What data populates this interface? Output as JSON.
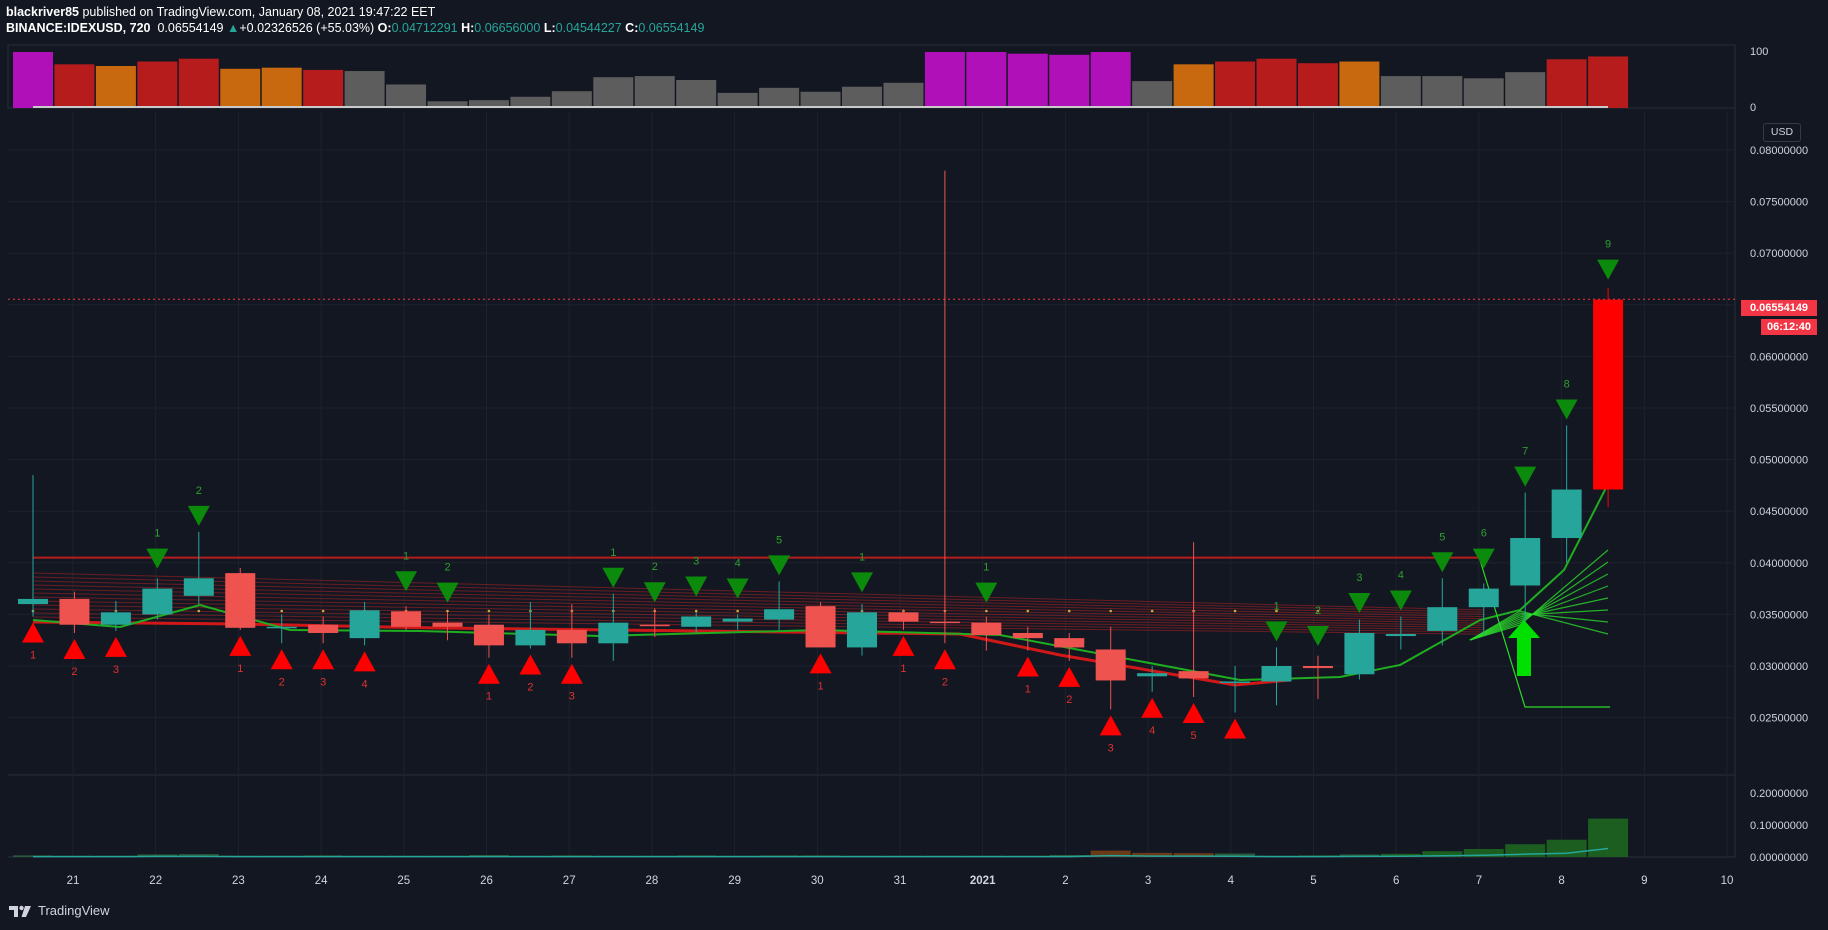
{
  "header": {
    "publisher": "blackriver85",
    "published_text": "published on TradingView.com, January 08, 2021 19:47:22 EET",
    "symbol": "BINANCE:IDEXUSD, 720",
    "last_price": "0.06554149",
    "change_arrow": "▲",
    "change": "+0.02326526 (+55.03%)",
    "open_label": "O:",
    "open": "0.04712291",
    "high_label": "H:",
    "high": "0.06656000",
    "low_label": "L:",
    "low": "0.04544227",
    "close_label": "C:",
    "close": "0.06554149"
  },
  "price_axis": {
    "currency": "USD",
    "ticks": [
      "0.08000000",
      "0.07500000",
      "0.07000000",
      "0.06500000",
      "0.06000000",
      "0.05500000",
      "0.05000000",
      "0.04500000",
      "0.04000000",
      "0.03500000",
      "0.03000000",
      "0.02500000"
    ],
    "last_price_tag": "0.06554149",
    "countdown_tag": "06:12:40"
  },
  "top_pane_axis": {
    "ticks": [
      "100",
      "0"
    ]
  },
  "volume_axis": {
    "ticks": [
      "0.20000000",
      "0.10000000",
      "0.00000000"
    ]
  },
  "time_axis": {
    "labels": [
      "21",
      "22",
      "23",
      "24",
      "25",
      "26",
      "27",
      "28",
      "29",
      "30",
      "31",
      "2021",
      "2",
      "3",
      "4",
      "5",
      "6",
      "7",
      "8",
      "9",
      "10"
    ]
  },
  "footer": {
    "brand": "TradingView"
  },
  "colors": {
    "background": "#131722",
    "up_candle": "#26a69a",
    "down_candle": "#ef5350",
    "last_candle": "#ff0000",
    "price_line": "#f23645",
    "sell_marker": "#0b8a0b",
    "buy_marker": "#ff0000",
    "bar_magenta": "#b010b8",
    "bar_red": "#b71c1c",
    "bar_orange": "#c8680f",
    "bar_gray": "#5d5d5d"
  },
  "chart_data": {
    "type": "candlestick",
    "symbol": "BINANCE:IDEXUSD",
    "interval": "720",
    "ohlc": [
      {
        "o": 0.036,
        "h": 0.0485,
        "l": 0.0348,
        "c": 0.0365
      },
      {
        "o": 0.0365,
        "h": 0.0372,
        "l": 0.0332,
        "c": 0.034
      },
      {
        "o": 0.034,
        "h": 0.0363,
        "l": 0.0334,
        "c": 0.0352
      },
      {
        "o": 0.035,
        "h": 0.0385,
        "l": 0.0345,
        "c": 0.0375
      },
      {
        "o": 0.0368,
        "h": 0.043,
        "l": 0.036,
        "c": 0.0385
      },
      {
        "o": 0.039,
        "h": 0.0395,
        "l": 0.0335,
        "c": 0.0337
      },
      {
        "o": 0.0337,
        "h": 0.035,
        "l": 0.0322,
        "c": 0.0338
      },
      {
        "o": 0.034,
        "h": 0.0348,
        "l": 0.0322,
        "c": 0.0332
      },
      {
        "o": 0.0327,
        "h": 0.0362,
        "l": 0.032,
        "c": 0.0354
      },
      {
        "o": 0.0353,
        "h": 0.0358,
        "l": 0.0335,
        "c": 0.0338
      },
      {
        "o": 0.0342,
        "h": 0.0352,
        "l": 0.0325,
        "c": 0.0338
      },
      {
        "o": 0.034,
        "h": 0.035,
        "l": 0.0308,
        "c": 0.032
      },
      {
        "o": 0.032,
        "h": 0.0362,
        "l": 0.0317,
        "c": 0.0335
      },
      {
        "o": 0.0335,
        "h": 0.036,
        "l": 0.0308,
        "c": 0.0322
      },
      {
        "o": 0.0322,
        "h": 0.037,
        "l": 0.0305,
        "c": 0.0342
      },
      {
        "o": 0.034,
        "h": 0.0356,
        "l": 0.0328,
        "c": 0.0339
      },
      {
        "o": 0.0338,
        "h": 0.0352,
        "l": 0.0332,
        "c": 0.0348
      },
      {
        "o": 0.0343,
        "h": 0.035,
        "l": 0.0335,
        "c": 0.0346
      },
      {
        "o": 0.0345,
        "h": 0.0382,
        "l": 0.0335,
        "c": 0.0355
      },
      {
        "o": 0.0358,
        "h": 0.0362,
        "l": 0.0318,
        "c": 0.0318
      },
      {
        "o": 0.0318,
        "h": 0.036,
        "l": 0.031,
        "c": 0.0352
      },
      {
        "o": 0.0352,
        "h": 0.0355,
        "l": 0.0335,
        "c": 0.0343
      },
      {
        "o": 0.0343,
        "h": 0.078,
        "l": 0.0322,
        "c": 0.0342
      },
      {
        "o": 0.0342,
        "h": 0.0348,
        "l": 0.0315,
        "c": 0.033
      },
      {
        "o": 0.0332,
        "h": 0.0338,
        "l": 0.0315,
        "c": 0.0327
      },
      {
        "o": 0.0327,
        "h": 0.0332,
        "l": 0.0305,
        "c": 0.0318
      },
      {
        "o": 0.0316,
        "h": 0.0338,
        "l": 0.0258,
        "c": 0.0286
      },
      {
        "o": 0.029,
        "h": 0.03,
        "l": 0.0275,
        "c": 0.0293
      },
      {
        "o": 0.0295,
        "h": 0.042,
        "l": 0.027,
        "c": 0.0288
      },
      {
        "o": 0.0285,
        "h": 0.03,
        "l": 0.0255,
        "c": 0.0285
      },
      {
        "o": 0.0285,
        "h": 0.0318,
        "l": 0.0262,
        "c": 0.03
      },
      {
        "o": 0.03,
        "h": 0.031,
        "l": 0.0268,
        "c": 0.0298
      },
      {
        "o": 0.0292,
        "h": 0.0345,
        "l": 0.0287,
        "c": 0.0332
      },
      {
        "o": 0.0329,
        "h": 0.0348,
        "l": 0.0316,
        "c": 0.0331
      },
      {
        "o": 0.0334,
        "h": 0.0385,
        "l": 0.032,
        "c": 0.0357
      },
      {
        "o": 0.0357,
        "h": 0.038,
        "l": 0.033,
        "c": 0.0375
      },
      {
        "o": 0.0378,
        "h": 0.0468,
        "l": 0.034,
        "c": 0.0424
      },
      {
        "o": 0.0424,
        "h": 0.0533,
        "l": 0.04,
        "c": 0.0471
      },
      {
        "o": 0.0471,
        "h": 0.0666,
        "l": 0.0454,
        "c": 0.0655
      }
    ],
    "volume": [
      0.005,
      0.004,
      0.004,
      0.008,
      0.009,
      0.004,
      0.004,
      0.005,
      0.004,
      0.004,
      0.004,
      0.006,
      0.004,
      0.005,
      0.004,
      0.004,
      0.005,
      0.004,
      0.005,
      0.005,
      0.004,
      0.004,
      0.004,
      0.004,
      0.004,
      0.006,
      0.02,
      0.013,
      0.012,
      0.011,
      0.004,
      0.005,
      0.008,
      0.01,
      0.018,
      0.025,
      0.04,
      0.054,
      0.12
    ],
    "top_pane_values": [
      100,
      78,
      75,
      83,
      88,
      70,
      72,
      68,
      66,
      42,
      12,
      14,
      20,
      30,
      55,
      57,
      50,
      27,
      36,
      29,
      38,
      45,
      100,
      100,
      97,
      95,
      100,
      48,
      78,
      83,
      88,
      80,
      83,
      57,
      57,
      53,
      64,
      87,
      92
    ],
    "sell_markers": [
      {
        "bar": 3,
        "label": "1"
      },
      {
        "bar": 4,
        "label": "2"
      },
      {
        "bar": 9,
        "label": "1"
      },
      {
        "bar": 10,
        "label": "2"
      },
      {
        "bar": 14,
        "label": "1"
      },
      {
        "bar": 15,
        "label": "2"
      },
      {
        "bar": 16,
        "label": "3"
      },
      {
        "bar": 17,
        "label": "4"
      },
      {
        "bar": 18,
        "label": "5"
      },
      {
        "bar": 20,
        "label": "1"
      },
      {
        "bar": 23,
        "label": "1"
      },
      {
        "bar": 30,
        "label": "1"
      },
      {
        "bar": 31,
        "label": "2"
      },
      {
        "bar": 32,
        "label": "3"
      },
      {
        "bar": 33,
        "label": "4"
      },
      {
        "bar": 34,
        "label": "5"
      },
      {
        "bar": 35,
        "label": "6"
      },
      {
        "bar": 36,
        "label": "7"
      },
      {
        "bar": 37,
        "label": "8"
      },
      {
        "bar": 38,
        "label": "9"
      }
    ],
    "buy_markers": [
      {
        "bar": 0,
        "label": "1"
      },
      {
        "bar": 1,
        "label": "2"
      },
      {
        "bar": 2,
        "label": "3"
      },
      {
        "bar": 5,
        "label": "1"
      },
      {
        "bar": 6,
        "label": "2"
      },
      {
        "bar": 7,
        "label": "3"
      },
      {
        "bar": 8,
        "label": "4"
      },
      {
        "bar": 11,
        "label": "1"
      },
      {
        "bar": 12,
        "label": "2"
      },
      {
        "bar": 13,
        "label": "3"
      },
      {
        "bar": 19,
        "label": "1"
      },
      {
        "bar": 21,
        "label": "1"
      },
      {
        "bar": 22,
        "label": "2"
      },
      {
        "bar": 24,
        "label": "1"
      },
      {
        "bar": 25,
        "label": "2"
      },
      {
        "bar": 26,
        "label": "3"
      },
      {
        "bar": 27,
        "label": "4"
      },
      {
        "bar": 28,
        "label": "5"
      },
      {
        "bar": 29,
        "label": ""
      }
    ],
    "resistance_line": 0.0405,
    "last_price": 0.06554149,
    "ylim": [
      0.0215,
      0.085
    ]
  }
}
